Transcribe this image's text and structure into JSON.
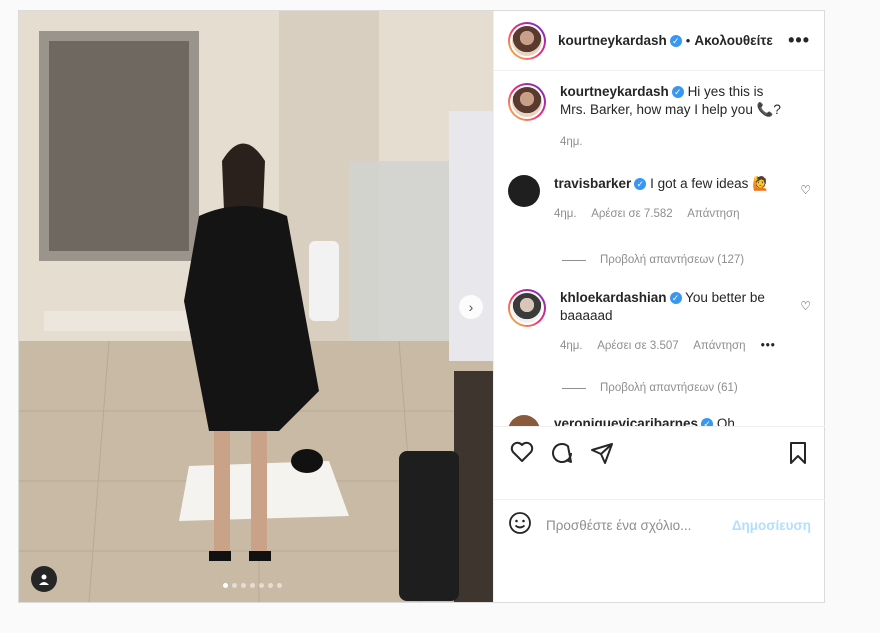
{
  "post": {
    "author": {
      "username": "kourtneykardash",
      "verified": true,
      "follow_label": "Ακολουθείτε",
      "separator": "•",
      "more_label": "•••"
    },
    "caption": {
      "username": "kourtneykardash",
      "text": "Hi yes this is Mrs. Barker, how may I help you 📞?",
      "time": "4ημ."
    },
    "comments": [
      {
        "username": "travisbarker",
        "verified": true,
        "text": "I got a few ideas 🙋",
        "time": "4ημ.",
        "likes": "Αρέσει σε 7.582",
        "reply_label": "Απάντηση",
        "view_replies": "Προβολή απαντήσεων (127)"
      },
      {
        "username": "khloekardashian",
        "verified": true,
        "text": "You better be baaaaad",
        "time": "4ημ.",
        "likes": "Αρέσει σε 3.507",
        "reply_label": "Απάντηση",
        "more_label": "•••",
        "view_replies": "Προβολή απαντήσεων (61)"
      },
      {
        "username": "veroniquevicaribarnes",
        "verified": true,
        "text": "Oh"
      }
    ],
    "add_comment": {
      "placeholder": "Προσθέστε ένα σχόλιο...",
      "post_label": "Δημοσίευση"
    },
    "carousel": {
      "slide_count": 7,
      "active_slide": 1
    },
    "colors": {
      "verified": "#3897f0",
      "post_button_disabled": "#b2dffc",
      "muted_text": "#8e8e8e"
    }
  }
}
